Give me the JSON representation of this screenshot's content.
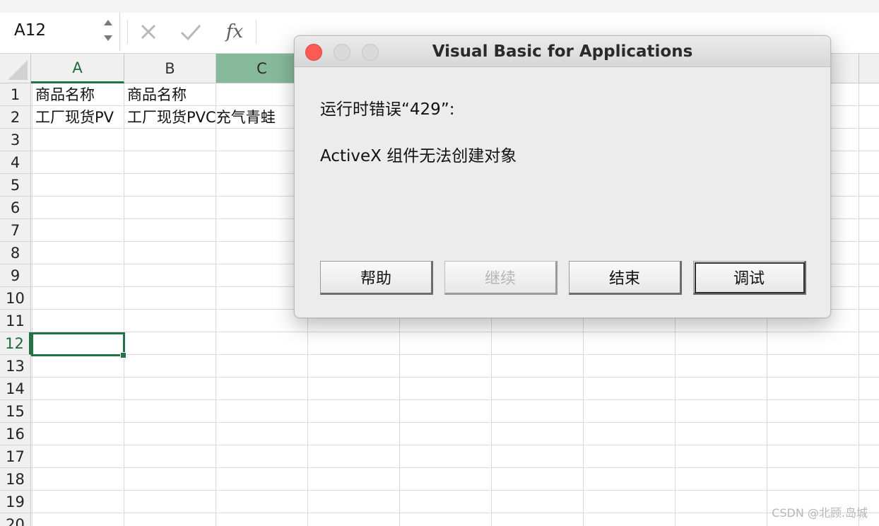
{
  "formula_bar": {
    "name_box": "A12",
    "cancel_icon": "close-icon",
    "enter_icon": "check-icon",
    "fx_label": "fx"
  },
  "columns": [
    "A",
    "B",
    "C"
  ],
  "rows": [
    "1",
    "2",
    "3",
    "4",
    "5",
    "6",
    "7",
    "8",
    "9",
    "10",
    "11",
    "12",
    "13",
    "14",
    "15",
    "16",
    "17",
    "18",
    "19",
    "20"
  ],
  "cells": {
    "A1": "商品名称",
    "B1": "商品名称",
    "A2": "工厂现货PV",
    "B2": "工厂现货PVC充气青蛙"
  },
  "active_cell": "A12",
  "dialog": {
    "title": "Visual Basic for Applications",
    "error_line": "运行时错误“429”:",
    "message": "ActiveX 组件无法创建对象",
    "buttons": {
      "help": "帮助",
      "continue": "继续",
      "end": "结束",
      "debug": "调试"
    }
  },
  "watermark": "CSDN @北顾.岛城",
  "colors": {
    "accent_green": "#217346",
    "selected_col_header": "#86b99a",
    "close_button_red": "#fb5a55"
  }
}
